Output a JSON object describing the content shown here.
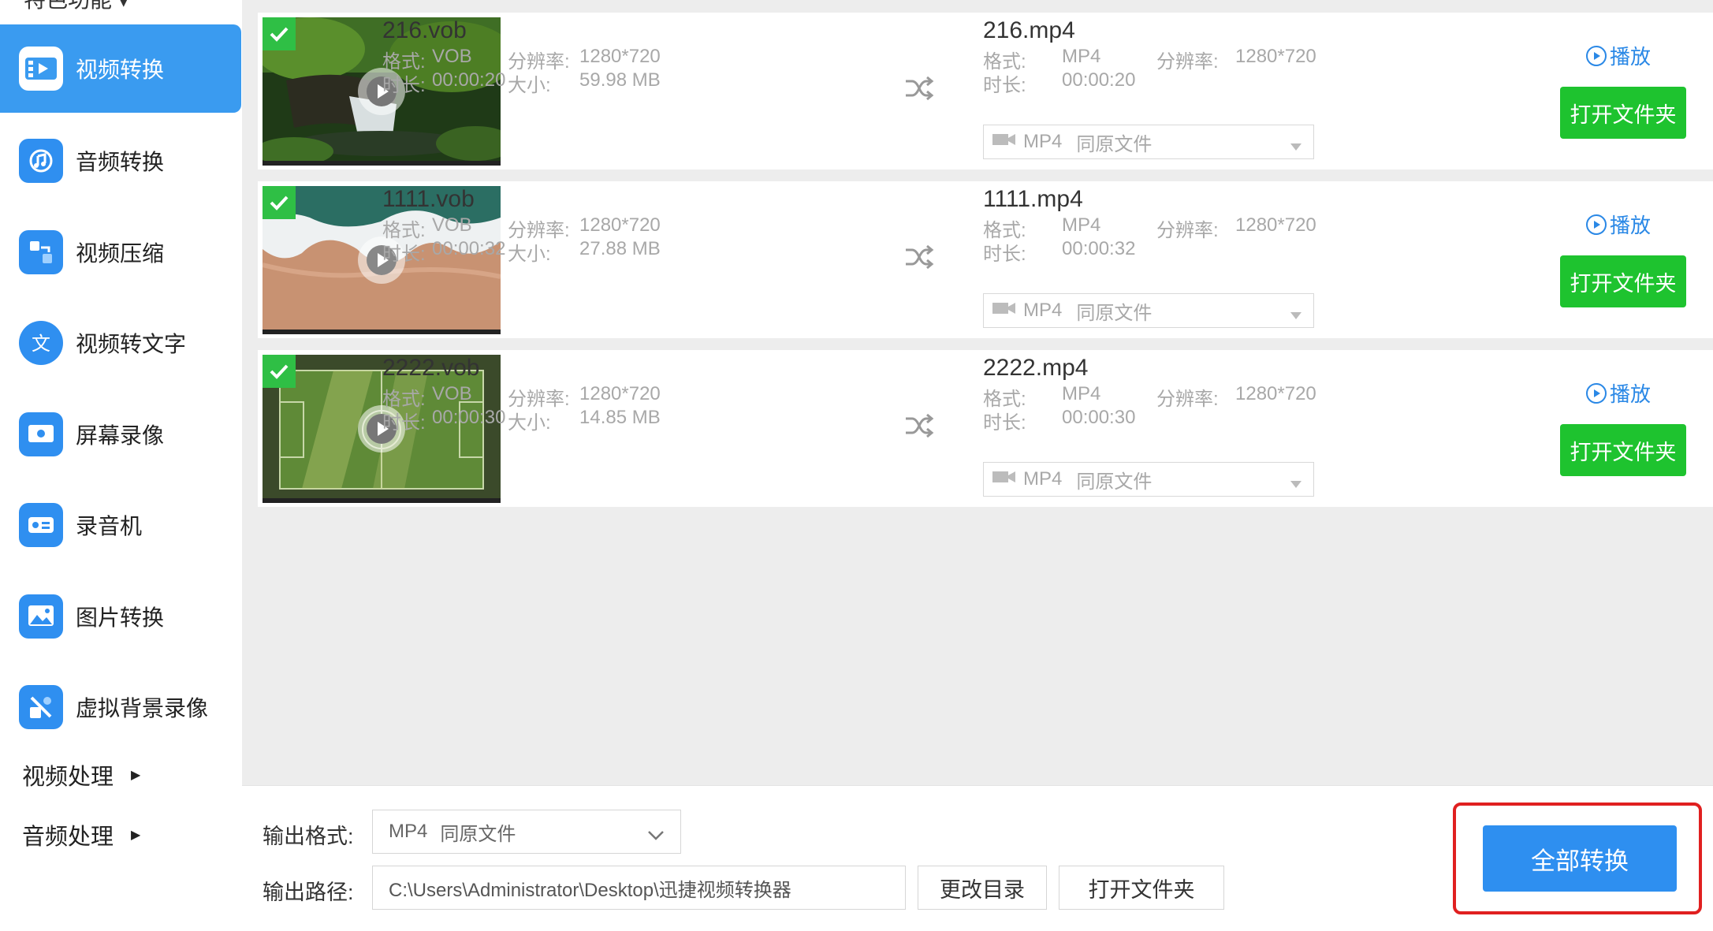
{
  "sidebar": {
    "partial_header": "特色功能 ▾",
    "items": [
      {
        "label": "视频转换",
        "icon": "video-convert-icon"
      },
      {
        "label": "音频转换",
        "icon": "audio-convert-icon"
      },
      {
        "label": "视频压缩",
        "icon": "video-compress-icon"
      },
      {
        "label": "视频转文字",
        "icon": "video-to-text-icon"
      },
      {
        "label": "屏幕录像",
        "icon": "screen-record-icon"
      },
      {
        "label": "录音机",
        "icon": "recorder-icon"
      },
      {
        "label": "图片转换",
        "icon": "image-convert-icon"
      },
      {
        "label": "虚拟背景录像",
        "icon": "virtual-background-icon"
      }
    ],
    "sections": [
      {
        "label": "视频处理"
      },
      {
        "label": "音频处理"
      }
    ]
  },
  "labels": {
    "format": "格式:",
    "resolution": "分辨率:",
    "duration": "时长:",
    "size": "大小:",
    "play": "播放",
    "open_folder": "打开文件夹",
    "same_as_source": "同原文件"
  },
  "files": [
    {
      "source": {
        "name": "216.vob",
        "format": "VOB",
        "resolution": "1280*720",
        "duration": "00:00:20",
        "size": "59.98 MB"
      },
      "output": {
        "name": "216.mp4",
        "format": "MP4",
        "resolution": "1280*720",
        "duration": "00:00:20",
        "format_select": "MP4"
      }
    },
    {
      "source": {
        "name": "1111.vob",
        "format": "VOB",
        "resolution": "1280*720",
        "duration": "00:00:32",
        "size": "27.88 MB"
      },
      "output": {
        "name": "1111.mp4",
        "format": "MP4",
        "resolution": "1280*720",
        "duration": "00:00:32",
        "format_select": "MP4"
      }
    },
    {
      "source": {
        "name": "2222.vob",
        "format": "VOB",
        "resolution": "1280*720",
        "duration": "00:00:30",
        "size": "14.85 MB"
      },
      "output": {
        "name": "2222.mp4",
        "format": "MP4",
        "resolution": "1280*720",
        "duration": "00:00:30",
        "format_select": "MP4"
      }
    }
  ],
  "bottom": {
    "format_label": "输出格式:",
    "format_value": "MP4",
    "format_suffix": "同原文件",
    "path_label": "输出路径:",
    "path_value": "C:\\Users\\Administrator\\Desktop\\迅捷视频转换器",
    "change_dir": "更改目录",
    "open_folder": "打开文件夹",
    "convert_all": "全部转换"
  },
  "colors": {
    "accent_blue": "#2e8ff0",
    "sidebar_active": "#3a9bf0",
    "open_folder_green": "#1ec32f",
    "check_green": "#2fbf45",
    "highlight_red": "#e02020"
  }
}
